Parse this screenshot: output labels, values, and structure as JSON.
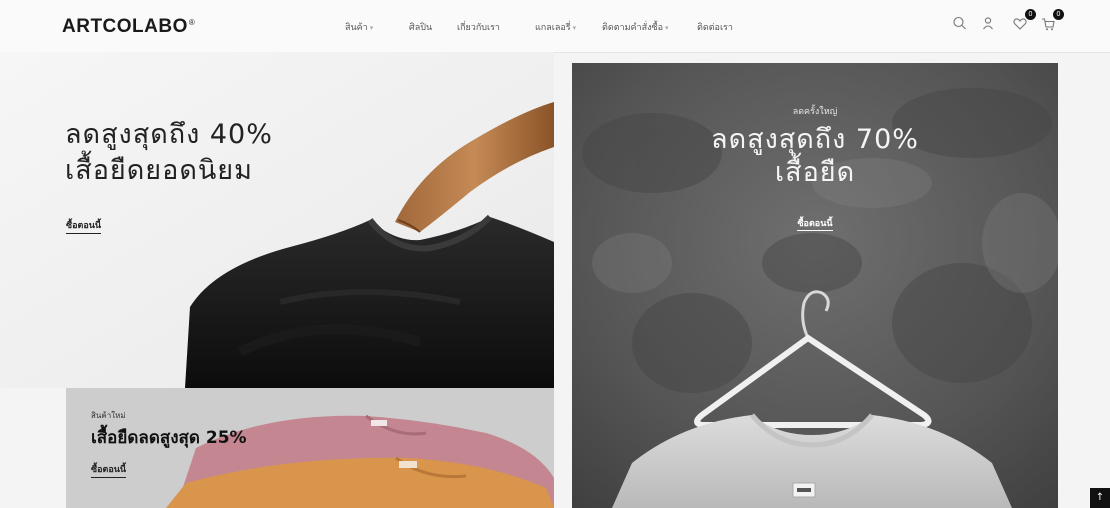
{
  "header": {
    "logo": "ARTCOLABO",
    "logo_mark": "®",
    "nav": [
      {
        "label": "สินค้า",
        "dropdown": true
      },
      {
        "label": "ศิลปิน",
        "dropdown": false
      },
      {
        "label": "เกี่ยวกับเรา",
        "dropdown": false
      },
      {
        "label": "แกลเลอรี่",
        "dropdown": true
      },
      {
        "label": "ติดตามคำสั่งซื้อ",
        "dropdown": true
      },
      {
        "label": "ติดต่อเรา",
        "dropdown": false
      }
    ],
    "icons": [
      "search-icon",
      "user-icon",
      "heart-icon",
      "cart-icon"
    ],
    "wishlist_count": "0",
    "cart_count": "0"
  },
  "banners": {
    "left": {
      "title_line1": "ลดสูงสุดถึง 40%",
      "title_line2": "เสื้อยืดยอดนิยม",
      "cta": "ซื้อตอนนี้"
    },
    "right": {
      "kicker": "ลดครั้งใหญ่",
      "title_line1": "ลดสูงสุดถึง 70%",
      "title_line2": "เสื้อยืด",
      "cta": "ซื้อตอนนี้"
    },
    "bottom": {
      "kicker": "สินค้าใหม่",
      "title": "เสื้อยืดลดสูงสุด 25%",
      "cta": "ซื้อตอนนี้"
    }
  },
  "scroll_top_icon": "arrow-up-icon",
  "colors": {
    "header_bg": "#fafafa",
    "text_dark": "#222222",
    "badge": "#111111"
  }
}
